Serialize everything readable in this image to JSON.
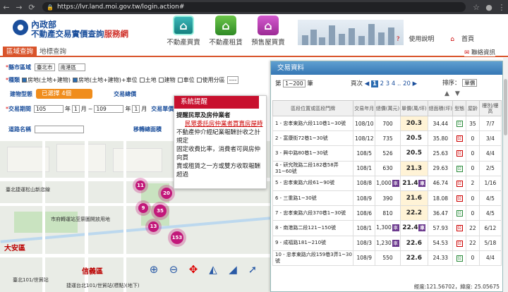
{
  "browser": {
    "url": "https://lvr.land.moi.gov.tw/login.action#"
  },
  "header": {
    "ministry": "內政部",
    "site_name_main": "不動產交易實價查詢",
    "site_name_brand": "服務網",
    "nav": [
      {
        "label": "不動產買賣",
        "icon": "house-icon"
      },
      {
        "label": "不動產租賃",
        "icon": "rental-icon"
      },
      {
        "label": "預售屋買賣",
        "icon": "presale-icon"
      }
    ],
    "help": "使用說明",
    "home": "首頁",
    "contact": "聯絡資訊"
  },
  "tabs": {
    "area_query": "區域查詢",
    "landmark_query": "地標查詢"
  },
  "form": {
    "county_label": "縣市區域",
    "county": "臺北市",
    "district": "南港區",
    "type_label": "種類",
    "type_options": [
      "房地(土地+建物)",
      "房地(土地+建物)+車位",
      "土地",
      "建物",
      "車位"
    ],
    "zone_label": "使用分區",
    "zone_value": "----",
    "building_label": "建物型態",
    "building_value": "已選擇 4個",
    "trade_label": "交易總價",
    "period_label": "交易期間",
    "from_year": "105",
    "from_month": "1",
    "to_year": "109",
    "to_month": "1",
    "month_char": "月",
    "year_char": "年",
    "unit_price_label": "交易單價",
    "road_label": "道路名稱",
    "move_label": "移轉總面積"
  },
  "map": {
    "labels": [
      "臺北捷運松山新店線",
      "市府轉運站至祭圖開放用地",
      "臺北101/世貿站",
      "捷運台北101/世貿站(標點)(地下)"
    ],
    "districts": [
      "大安區",
      "信義區"
    ],
    "clusters": [
      "11",
      "20",
      "9",
      "35",
      "13",
      "153"
    ]
  },
  "notice": {
    "title": "系統提醒",
    "heading": "提醒民眾及房仲業者",
    "highlight": "民眾委託房仲業者買賣房屋時",
    "lines": [
      "不動產仲介經紀業報酬計收之計",
      "規定",
      "固定收費比率，消費者可與房仲",
      "向買",
      "賣或租賃之一方或雙方收取報酬",
      "超過"
    ]
  },
  "results": {
    "title": "交易資料",
    "page_prefix": "第",
    "page_range": "1~200",
    "page_suffix": "筆",
    "pages_label": "頁次",
    "pages": [
      "1",
      "2",
      "3",
      "4",
      "20"
    ],
    "sort_label": "排序：",
    "sort_value": "單價",
    "headers": [
      "區段位置或區段門牌",
      "交易年月",
      "總價(萬元)",
      "單價(萬/坪)",
      "總面積(坪)",
      "型態",
      "屋齡",
      "樓別/樓高"
    ],
    "rows": [
      {
        "addr": "1 - 忠孝東路六段110巷1~30號",
        "ym": "108/10",
        "total": "700",
        "unit": "20.3",
        "area": "34.44",
        "age": "35",
        "floor": "7/7",
        "tag_t": false,
        "tag_u": false
      },
      {
        "addr": "2 - 富康街72巷1~30號",
        "ym": "108/12",
        "total": "735",
        "unit": "20.5",
        "area": "35.80",
        "age": "0",
        "floor": "3/4",
        "tag_t": false,
        "tag_u": false
      },
      {
        "addr": "3 - 興中路80巷1~30號",
        "ym": "108/5",
        "total": "526",
        "unit": "20.5",
        "area": "25.63",
        "age": "0",
        "floor": "4/4",
        "tag_t": false,
        "tag_u": false
      },
      {
        "addr": "4 - 研究院路二段182巷58弄31~60號",
        "ym": "108/1",
        "total": "630",
        "unit": "21.3",
        "area": "29.63",
        "age": "0",
        "floor": "2/5",
        "tag_t": false,
        "tag_u": false
      },
      {
        "addr": "5 - 忠孝東路六段61~90號",
        "ym": "108/8",
        "total": "1,000",
        "unit": "21.4",
        "area": "46.74",
        "age": "2",
        "floor": "1/16",
        "tag_t": true,
        "tag_u": true
      },
      {
        "addr": "6 - 三重路1~30號",
        "ym": "108/9",
        "total": "390",
        "unit": "21.6",
        "area": "18.08",
        "age": "0",
        "floor": "4/5",
        "tag_t": false,
        "tag_u": false
      },
      {
        "addr": "7 - 忠孝東路六段370巷1~30號",
        "ym": "108/6",
        "total": "810",
        "unit": "22.2",
        "area": "36.47",
        "age": "0",
        "floor": "4/5",
        "tag_t": false,
        "tag_u": false
      },
      {
        "addr": "8 - 南港路二段121~150號",
        "ym": "108/1",
        "total": "1,300",
        "unit": "22.4",
        "area": "57.93",
        "age": "22",
        "floor": "6/12",
        "tag_t": true,
        "tag_u": true
      },
      {
        "addr": "9 - 成福路181~210號",
        "ym": "108/3",
        "total": "1,230",
        "unit": "22.6",
        "area": "54.53",
        "age": "22",
        "floor": "5/18",
        "tag_t": true,
        "tag_u": false
      },
      {
        "addr": "10 - 忠孝東路六段159巷3弄1~30號",
        "ym": "108/9",
        "total": "550",
        "unit": "22.6",
        "area": "24.33",
        "age": "0",
        "floor": "4/4",
        "tag_t": false,
        "tag_u": false
      }
    ],
    "tag_t_text": "車",
    "tag_u_text": "車",
    "type_mark": "公",
    "coord": "經度:121.56702，緯度: 25.05675"
  }
}
